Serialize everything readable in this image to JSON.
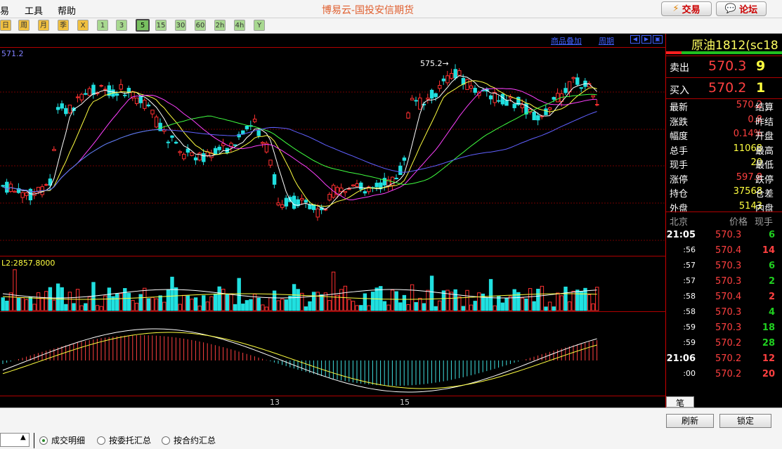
{
  "menu": [
    "易",
    "工具",
    "帮助"
  ],
  "app_title": "博易云-国投安信期货",
  "top_buttons": {
    "trade": "交易",
    "forum": "论坛"
  },
  "periods": [
    "日",
    "周",
    "月",
    "季",
    "X",
    "1",
    "3",
    "5",
    "15",
    "30",
    "60",
    "2h",
    "4h",
    "Y"
  ],
  "selected_period": "5",
  "chart_links": {
    "overlay": "商品叠加",
    "cycle": "周期"
  },
  "main_label": "571.2",
  "price_marker": "575.2",
  "volume_label": "L2:2857.8000",
  "x_ticks": [
    "13",
    "15"
  ],
  "contract": "原油1812(sc18",
  "quote": {
    "sell_label": "卖出",
    "sell_price": "570.3",
    "sell_vol": "9",
    "buy_label": "买入",
    "buy_price": "570.2",
    "buy_vol": "1"
  },
  "stats": [
    {
      "label": "最新",
      "value": "570.2",
      "label2": "结算"
    },
    {
      "label": "涨跌",
      "value": "0.8",
      "label2": "昨结"
    },
    {
      "label": "幅度",
      "value": "0.14%",
      "label2": "开盘"
    },
    {
      "label": "总手",
      "value": "11068",
      "label2": "最高"
    },
    {
      "label": "现手",
      "value": "20",
      "label2": "最低"
    },
    {
      "label": "涨停",
      "value": "597.8",
      "label2": "跌停"
    },
    {
      "label": "持仓",
      "value": "37568",
      "label2": "仓差"
    },
    {
      "label": "外盘",
      "value": "5143",
      "label2": "内盘"
    }
  ],
  "ticks_header": {
    "time": "北京",
    "price": "价格",
    "vol": "现手"
  },
  "ticks": [
    {
      "time": "21:05",
      "price": "570.3",
      "vol": "6",
      "vcolor": "#20d020"
    },
    {
      "time": ":56",
      "price": "570.4",
      "vol": "14",
      "vcolor": "#ff4040"
    },
    {
      "time": ":57",
      "price": "570.3",
      "vol": "6",
      "vcolor": "#20d020"
    },
    {
      "time": ":57",
      "price": "570.3",
      "vol": "2",
      "vcolor": "#20d020"
    },
    {
      "time": ":58",
      "price": "570.4",
      "vol": "2",
      "vcolor": "#ff4040"
    },
    {
      "time": ":58",
      "price": "570.3",
      "vol": "4",
      "vcolor": "#20d020"
    },
    {
      "time": ":59",
      "price": "570.3",
      "vol": "18",
      "vcolor": "#20d020"
    },
    {
      "time": ":59",
      "price": "570.2",
      "vol": "28",
      "vcolor": "#20d020"
    },
    {
      "time": "21:06",
      "price": "570.2",
      "vol": "12",
      "vcolor": "#ff4040"
    },
    {
      "time": ":00",
      "price": "570.2",
      "vol": "20",
      "vcolor": "#ff4040"
    }
  ],
  "tick_tab": "笔",
  "buttons": {
    "refresh": "刷新",
    "lock": "锁定"
  },
  "radios": [
    "成交明细",
    "按委托汇总",
    "按合约汇总"
  ],
  "selected_radio": "成交明细"
}
